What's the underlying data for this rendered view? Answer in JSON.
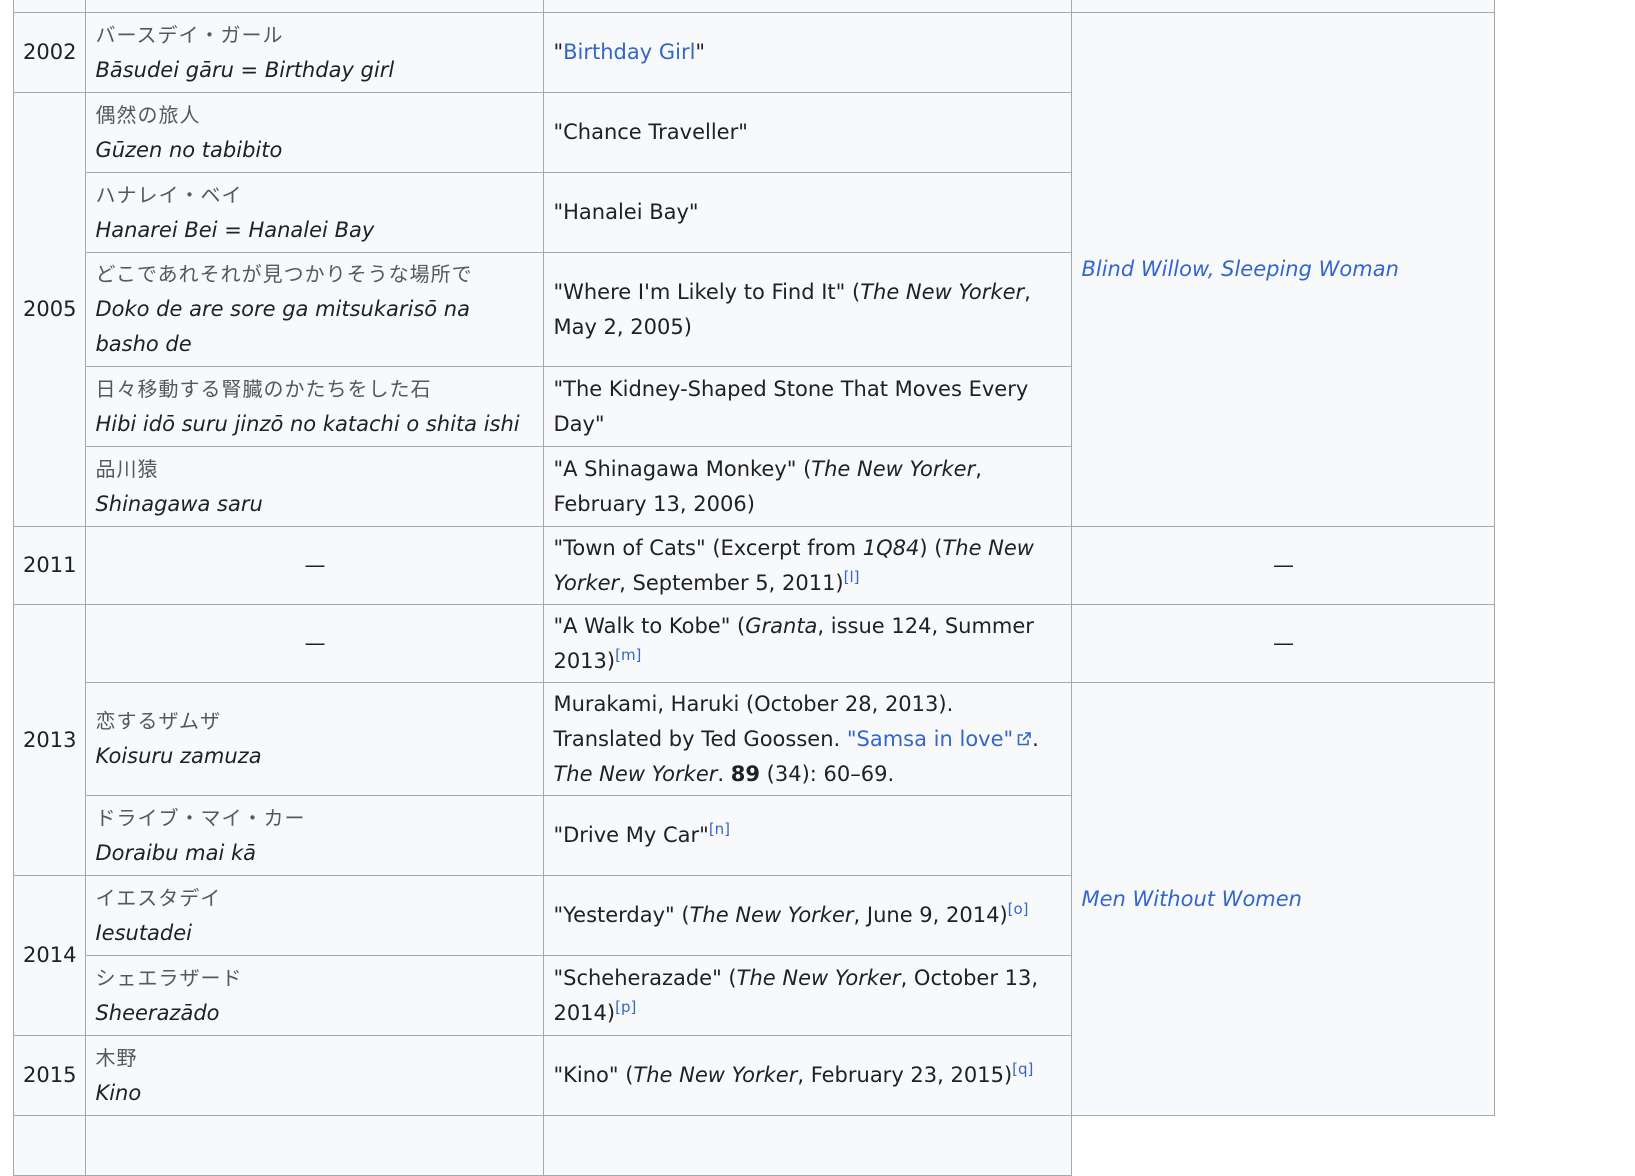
{
  "rows": {
    "top_partial": {
      "jp": "",
      "romaji": "…",
      "english": ""
    },
    "birthday_girl": {
      "year": "2002",
      "jp": "バースデイ・ガール",
      "romaji": "Bāsudei gāru = Birthday girl",
      "english_link": "Birthday Girl"
    },
    "chance_traveller": {
      "jp": "偶然の旅人",
      "romaji": "Gūzen no tabibito",
      "english": "\"Chance Traveller\""
    },
    "hanalei_bay": {
      "jp": "ハナレイ・ベイ",
      "romaji": "Hanarei Bei = Hanalei Bay",
      "english": "\"Hanalei Bay\""
    },
    "where_likely": {
      "jp": "どこであれそれが見つかりそうな場所で",
      "romaji": "Doko de are sore ga mitsukarisō na basho de",
      "english_title": "\"Where I'm Likely to Find It\" (",
      "publication": "The New Yorker",
      "date": ", May 2, 2005)"
    },
    "kidney_stone": {
      "jp": "日々移動する腎臓のかたちをした石",
      "romaji": "Hibi idō suru jinzō no katachi o shita ishi",
      "english": "\"The Kidney-Shaped Stone That Moves Every Day\""
    },
    "shinagawa": {
      "jp": "品川猿",
      "romaji": "Shinagawa saru",
      "english_title": "\"A Shinagawa Monkey\" (",
      "publication": "The New Yorker",
      "date": ", February 13, 2006)"
    },
    "year_2005": "2005",
    "collection_blind_willow": "Blind Willow, Sleeping Woman",
    "town_of_cats": {
      "year": "2011",
      "jp": "—",
      "english_title": "\"Town of Cats\" (Excerpt from ",
      "excerpt_of": "1Q84",
      "mid": ") (",
      "publication": "The New Yorker",
      "date": ", September 5, 2011)",
      "ref": "[l]",
      "collection": "—"
    },
    "walk_to_kobe": {
      "jp": "—",
      "english_title": "\"A Walk to Kobe\" (",
      "publication": "Granta",
      "date": ", issue 124, Summer 2013)",
      "ref": "[m]",
      "collection": "—"
    },
    "year_2013": "2013",
    "samsa": {
      "jp": "恋するザムザ",
      "romaji": "Koisuru zamuza",
      "cite_start": "Murakami, Haruki (October 28, 2013). Translated by Ted Goossen. ",
      "cite_link": "\"Samsa in love\"",
      "cite_sep": ". ",
      "publication": "The New Yorker",
      "cite_dot": ". ",
      "volume": "89",
      "issue_pages": " (34): 60–69."
    },
    "drive_my_car": {
      "jp": "ドライブ・マイ・カー",
      "romaji": "Doraibu mai kā",
      "english": "\"Drive My Car\"",
      "ref": "[n]"
    },
    "year_2014": "2014",
    "yesterday": {
      "jp": "イエスタデイ",
      "romaji": "Iesutadei",
      "english_title": "\"Yesterday\" (",
      "publication": "The New Yorker",
      "date": ", June 9, 2014)",
      "ref": "[o]"
    },
    "scheherazade": {
      "jp": "シェエラザード",
      "romaji": "Sheerazādo",
      "english_title": "\"Scheherazade\" (",
      "publication": "The New Yorker",
      "date": ", October 13, 2014)",
      "ref": "[p]"
    },
    "kino": {
      "year": "2015",
      "jp": "木野",
      "romaji": "Kino",
      "english_title": "\"Kino\" (",
      "publication": "The New Yorker",
      "date": ", February 23, 2015)",
      "ref": "[q]"
    },
    "collection_men_without_women": "Men Without Women"
  },
  "colors": {
    "link": "#3366cc",
    "border": "#a2a9b1",
    "cell_bg": "#f8f9fa",
    "text": "#202122"
  },
  "icons": {
    "external_link": "external-link-icon"
  }
}
